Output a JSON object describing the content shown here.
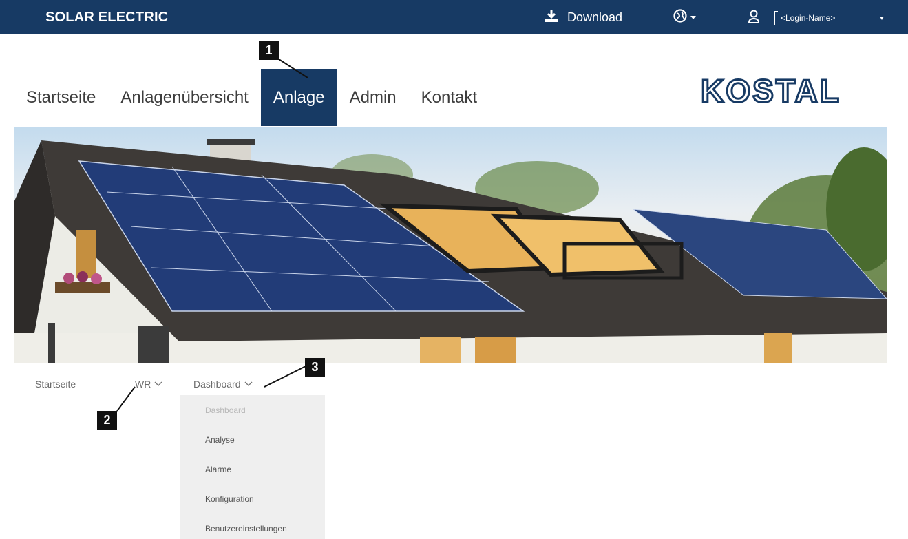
{
  "topbar": {
    "brand": "SOLAR ELECTRIC",
    "download_label": "Download",
    "login_label": "<Login-Name>",
    "icons": {
      "download": "download-icon",
      "language": "globe-icon",
      "user": "user-icon"
    }
  },
  "nav": {
    "items": [
      {
        "label": "Startseite",
        "active": false
      },
      {
        "label": "Anlagenübersicht",
        "active": false
      },
      {
        "label": "Anlage",
        "active": true
      },
      {
        "label": "Admin",
        "active": false
      },
      {
        "label": "Kontakt",
        "active": false
      }
    ],
    "logo": "KOSTAL"
  },
  "breadcrumb": {
    "home": "Startseite",
    "device": "WR",
    "section": "Dashboard"
  },
  "dropdown": {
    "items": [
      {
        "label": "Dashboard",
        "current": true
      },
      {
        "label": "Analyse",
        "current": false
      },
      {
        "label": "Alarme",
        "current": false
      },
      {
        "label": "Konfiguration",
        "current": false
      },
      {
        "label": "Benutzereinstellungen",
        "current": false
      }
    ]
  },
  "callouts": [
    "1",
    "2",
    "3"
  ],
  "colors": {
    "primary": "#173a64",
    "marker": "#111111",
    "dropdown_bg": "#efefef"
  }
}
